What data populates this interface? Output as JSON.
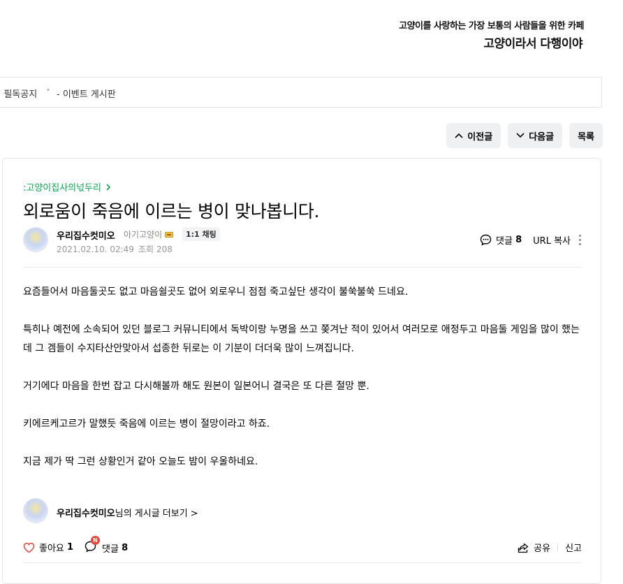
{
  "banner": {
    "line1": "고양이를 사랑하는 가장 보통의 사람들을 위한 카페",
    "line2": "고양이라서 다행이야"
  },
  "menu": {
    "notice": "! 필독공지",
    "event_board": "- 이벤트 게시판"
  },
  "nav": {
    "prev_label": "이전글",
    "next_label": "다음글",
    "list_label": "목록"
  },
  "article": {
    "board": ":고양이집사의넋두리",
    "title": "외로움이 죽음에 이르는 병이 맞나봅니다.",
    "author": {
      "name": "우리집수컷미오",
      "grade": "아기고양이",
      "chat_label": "1:1 채팅"
    },
    "date": "2021.02.10. 02:49",
    "views_label": "조회",
    "views": "208",
    "comment_label": "댓글",
    "comment_count": "8",
    "url_copy_label": "URL 복사",
    "paragraphs": [
      "요즘들어서 마음둘곳도 없고 마음쉴곳도 없어 외로우니 점점 죽고싶단 생각이 불쑥불쑥 드네요.",
      "특히나 예전에 소속되어 있던 블로그 커뮤니티에서 독박이랑 누명을 쓰고 쫒겨난 적이 있어서 여러모로 애정두고 마음둘 게임을 많이 했는데 그 겜들이 수지타산안맞아서 섭종한 뒤로는 이 기분이 더더욱 많이 느껴집니다.",
      "거기에다 마음을 한번 잡고 다시해볼까 해도 원본이 일본어니 결국은 또 다른 절망 뿐.",
      "키에르케고르가 말했듯 죽음에 이르는 병이 절망이라고 하죠.",
      "지금 제가 딱 그런 상황인거 같아 오늘도 밤이 우울하네요."
    ],
    "more_posts": {
      "author": "우리집수컷미오",
      "suffix": "님의 게시글 더보기 >"
    }
  },
  "bottom": {
    "like_label": "좋아요",
    "like_count": "1",
    "comment_label": "댓글",
    "comment_count": "8",
    "new_badge": "N",
    "share_label": "공유",
    "report_label": "신고"
  },
  "colors": {
    "accent_green": "#03a94d",
    "like_red": "#e8463b"
  }
}
